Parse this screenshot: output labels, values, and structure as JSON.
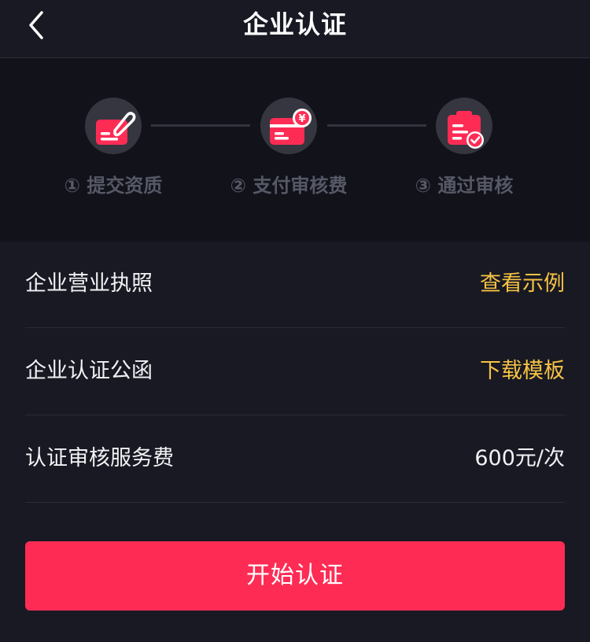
{
  "header": {
    "title": "企业认证"
  },
  "steps": [
    {
      "label": "① 提交资质",
      "icon": "edit-document-icon"
    },
    {
      "label": "② 支付审核费",
      "icon": "payment-card-icon"
    },
    {
      "label": "③ 通过审核",
      "icon": "approved-badge-icon"
    }
  ],
  "rows": {
    "license": {
      "label": "企业营业执照",
      "action": "查看示例"
    },
    "letter": {
      "label": "企业认证公函",
      "action": "下载模板"
    },
    "fee": {
      "label": "认证审核服务费",
      "value": "600元/次"
    }
  },
  "primary_button": {
    "label": "开始认证"
  },
  "colors": {
    "accent": "#fe2c55",
    "link": "#f6c244",
    "background": "#181923",
    "step_band": "#11121a"
  }
}
